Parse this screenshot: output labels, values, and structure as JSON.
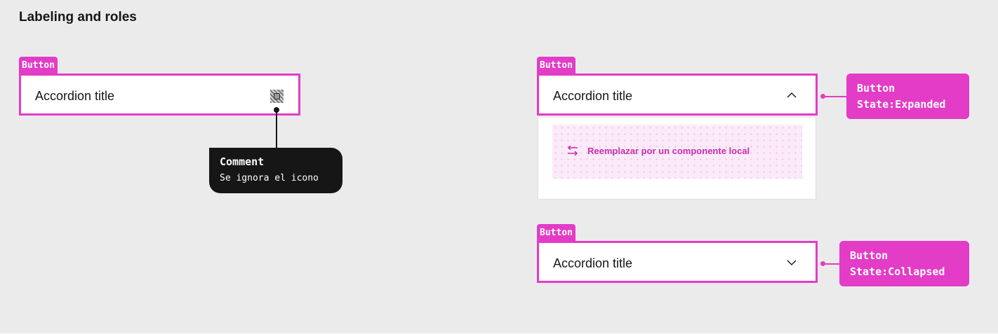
{
  "page": {
    "title": "Labeling and roles"
  },
  "colors": {
    "accent": "#e33cc7",
    "dark": "#161616",
    "background": "#ebebeb"
  },
  "left_example": {
    "tag": "Button",
    "accordion_title": "Accordion title",
    "icon": "placeholder-icon",
    "comment": {
      "title": "Comment",
      "body": "Se ignora el icono"
    }
  },
  "expanded_example": {
    "tag": "Button",
    "accordion_title": "Accordion title",
    "icon": "chevron-up-icon",
    "panel": {
      "icon": "swap-icon",
      "text": "Reemplazar por un componente local"
    },
    "annotation": {
      "line1": "Button",
      "line2": "State:Expanded"
    }
  },
  "collapsed_example": {
    "tag": "Button",
    "accordion_title": "Accordion title",
    "icon": "chevron-down-icon",
    "annotation": {
      "line1": "Button",
      "line2": "State:Collapsed"
    }
  }
}
